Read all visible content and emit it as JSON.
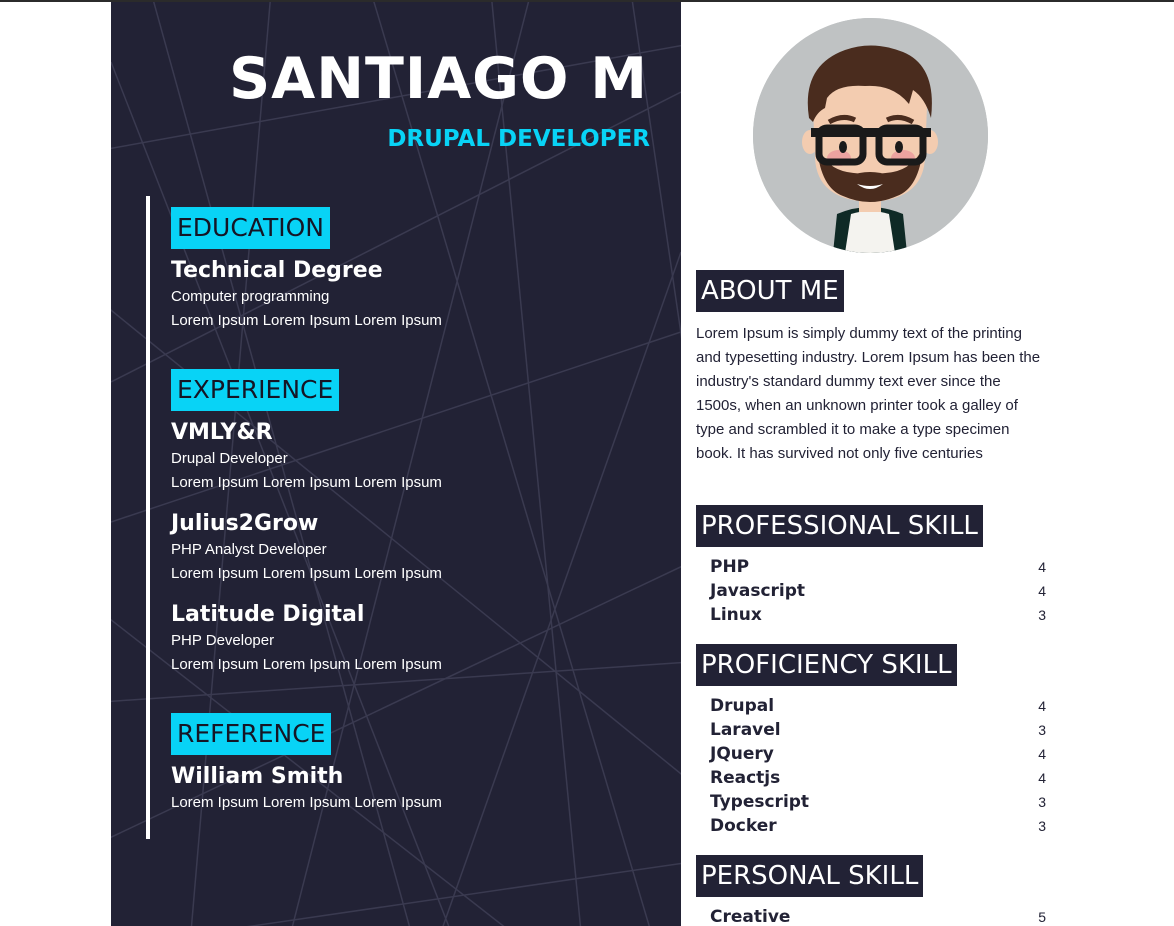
{
  "header": {
    "name": "SANTIAGO M",
    "role": "DRUPAL DEVELOPER"
  },
  "education": {
    "title": "EDUCATION",
    "items": [
      {
        "title": "Technical Degree",
        "subtitle": "Computer programming",
        "description": "Lorem Ipsum Lorem Ipsum Lorem Ipsum"
      }
    ]
  },
  "experience": {
    "title": "EXPERIENCE",
    "items": [
      {
        "title": "VMLY&R",
        "subtitle": "Drupal Developer",
        "description": "Lorem Ipsum Lorem Ipsum Lorem Ipsum"
      },
      {
        "title": "Julius2Grow",
        "subtitle": "PHP Analyst Developer",
        "description": "Lorem Ipsum Lorem Ipsum Lorem Ipsum"
      },
      {
        "title": "Latitude Digital",
        "subtitle": "PHP Developer",
        "description": "Lorem Ipsum Lorem Ipsum Lorem Ipsum"
      }
    ]
  },
  "reference": {
    "title": "REFERENCE",
    "items": [
      {
        "title": "William Smith",
        "description": "Lorem Ipsum Lorem Ipsum Lorem Ipsum"
      }
    ]
  },
  "about": {
    "title": "ABOUT ME",
    "text": "Lorem Ipsum is simply dummy text of the printing and typesetting industry. Lorem Ipsum has been the industry's standard dummy text ever since the 1500s, when an unknown printer took a galley of type and scrambled it to make a type specimen book. It has survived not only five centuries"
  },
  "professional_skill": {
    "title": "PROFESSIONAL SKILL",
    "items": [
      {
        "name": "PHP",
        "level": "4"
      },
      {
        "name": "Javascript",
        "level": "4"
      },
      {
        "name": "Linux",
        "level": "3"
      }
    ]
  },
  "proficiency_skill": {
    "title": "PROFICIENCY SKILL",
    "items": [
      {
        "name": "Drupal",
        "level": "4"
      },
      {
        "name": "Laravel",
        "level": "3"
      },
      {
        "name": "JQuery",
        "level": "4"
      },
      {
        "name": "Reactjs",
        "level": "4"
      },
      {
        "name": "Typescript",
        "level": "3"
      },
      {
        "name": "Docker",
        "level": "3"
      }
    ]
  },
  "personal_skill": {
    "title": "PERSONAL SKILL",
    "items": [
      {
        "name": "Creative",
        "level": "5"
      }
    ]
  },
  "icons": {
    "avatar": "bearded-man-with-glasses-avatar"
  },
  "colors": {
    "panel_dark": "#222235",
    "accent_cyan": "#08d3f6"
  }
}
